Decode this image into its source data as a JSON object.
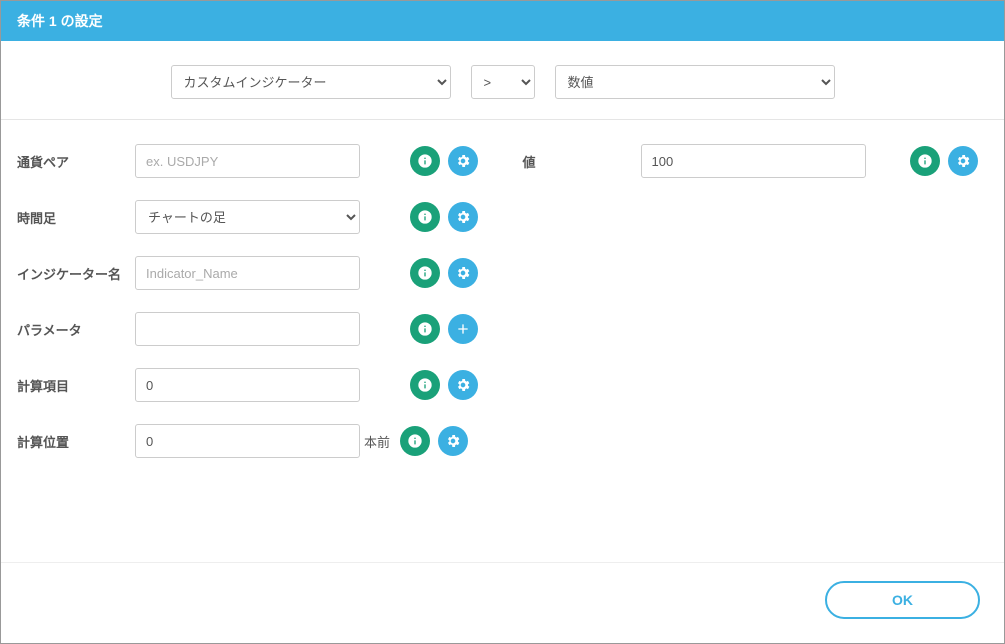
{
  "header": {
    "title": "条件 1 の設定"
  },
  "top": {
    "type_selected": "カスタムインジケーター",
    "operator_selected": ">",
    "value_type_selected": "数値"
  },
  "left": {
    "currency_pair": {
      "label": "通貨ペア",
      "placeholder": "ex. USDJPY",
      "value": ""
    },
    "timeframe": {
      "label": "時間足",
      "selected": "チャートの足"
    },
    "indicator_name": {
      "label": "インジケーター名",
      "placeholder": "Indicator_Name",
      "value": ""
    },
    "parameter": {
      "label": "パラメータ",
      "placeholder": "",
      "value": ""
    },
    "calc_item": {
      "label": "計算項目",
      "value": "0"
    },
    "calc_position": {
      "label": "計算位置",
      "value": "0",
      "suffix": "本前"
    }
  },
  "right": {
    "value": {
      "label": "値",
      "value": "100"
    }
  },
  "footer": {
    "ok_label": "OK"
  }
}
